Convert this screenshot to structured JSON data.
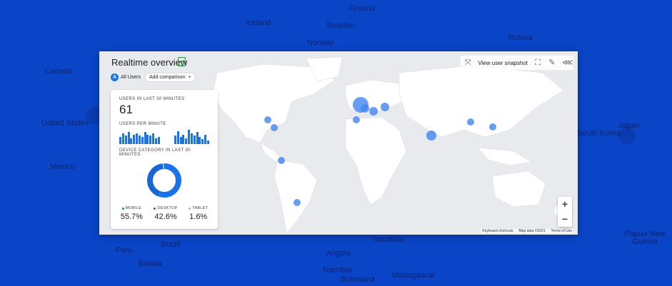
{
  "background": {
    "labels": [
      {
        "id": "finland",
        "text": "Finland"
      },
      {
        "id": "iceland",
        "text": "Iceland"
      },
      {
        "id": "sweden",
        "text": "Sweden"
      },
      {
        "id": "norway",
        "text": "Norway"
      },
      {
        "id": "russia",
        "text": "Russia"
      },
      {
        "id": "canada",
        "text": "Canada"
      },
      {
        "id": "united-states",
        "text": "United States"
      },
      {
        "id": "mexico",
        "text": "Mexico"
      },
      {
        "id": "south-korea",
        "text": "South Korea"
      },
      {
        "id": "japan",
        "text": "Japan"
      },
      {
        "id": "papua",
        "text": "Papua New Guinea"
      },
      {
        "id": "peru",
        "text": "Peru"
      },
      {
        "id": "brazil",
        "text": "Brazil"
      },
      {
        "id": "bolivia",
        "text": "Bolivia"
      },
      {
        "id": "angola",
        "text": "Angola"
      },
      {
        "id": "tanzania",
        "text": "Tanzania"
      },
      {
        "id": "namibia",
        "text": "Namibia"
      },
      {
        "id": "botswana",
        "text": "Botswana"
      },
      {
        "id": "madagascar",
        "text": "Madagascar"
      }
    ],
    "accent": "#0a45c8"
  },
  "header": {
    "title": "Realtime overview",
    "view_snapshot": "View user snapshot"
  },
  "chips": {
    "avatar_letter": "A",
    "all_users": "All Users",
    "add_comparison": "Add comparison",
    "add_symbol": "+"
  },
  "card": {
    "users_label": "USERS IN LAST 30 MINUTES",
    "users_value": "61",
    "per_minute_label": "USERS PER MINUTE",
    "per_minute_bars": [
      6,
      9,
      7,
      10,
      5,
      8,
      9,
      7,
      6,
      10,
      8,
      7,
      9,
      5,
      6,
      0,
      0,
      0,
      0,
      0,
      7,
      11,
      6,
      8,
      5,
      12,
      9,
      7,
      10,
      6,
      4,
      8,
      3
    ],
    "device_label": "DEVICE CATEGORY IN LAST 30 MINUTES",
    "devices": [
      {
        "name": "MOBILE",
        "value": "55.7%",
        "share": 55.7,
        "color": "#1a73e8"
      },
      {
        "name": "DESKTOP",
        "value": "42.6%",
        "share": 42.6,
        "color": "#1967d2"
      },
      {
        "name": "TABLET",
        "value": "1.6%",
        "share": 1.6,
        "color": "#8ab4f8"
      }
    ]
  },
  "zoom": {
    "in": "+",
    "out": "−"
  },
  "attribution": {
    "shortcuts": "Keyboard shortcuts",
    "map_data": "Map data ©2021",
    "terms": "Terms of Use"
  },
  "colors": {
    "land": "#ffffff",
    "water": "#e8eaed",
    "dot": "#4285f4",
    "bar": "#1a73e8"
  }
}
